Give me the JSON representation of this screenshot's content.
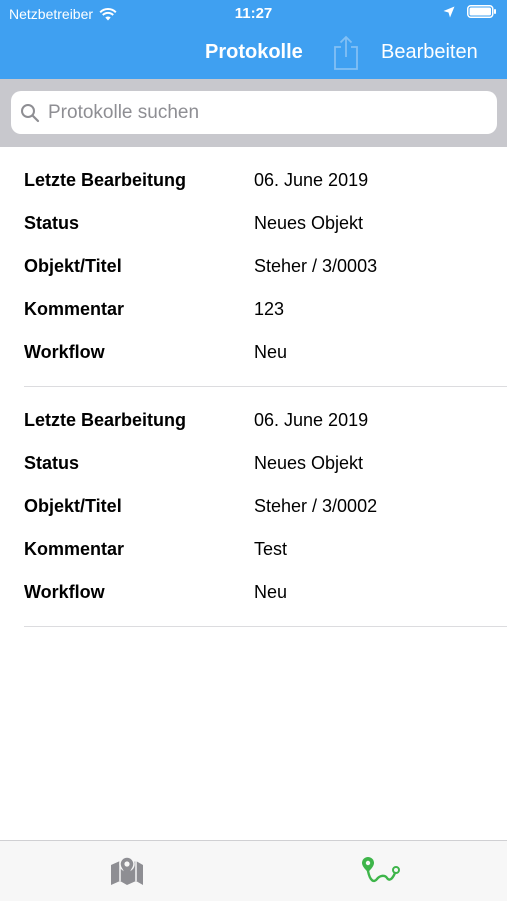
{
  "status_bar": {
    "carrier": "Netzbetreiber",
    "time": "11:27"
  },
  "nav": {
    "title": "Protokolle",
    "edit_label": "Bearbeiten"
  },
  "search": {
    "placeholder": "Protokolle suchen"
  },
  "records": [
    {
      "fields": [
        {
          "label": "Letzte Bearbeitung",
          "value": "06. June 2019"
        },
        {
          "label": "Status",
          "value": "Neues Objekt"
        },
        {
          "label": "Objekt/Titel",
          "value": "Steher / 3/0003"
        },
        {
          "label": "Kommentar",
          "value": "123"
        },
        {
          "label": "Workflow",
          "value": "Neu"
        }
      ]
    },
    {
      "fields": [
        {
          "label": "Letzte Bearbeitung",
          "value": "06. June 2019"
        },
        {
          "label": "Status",
          "value": "Neues Objekt"
        },
        {
          "label": "Objekt/Titel",
          "value": "Steher / 3/0002"
        },
        {
          "label": "Kommentar",
          "value": "Test"
        },
        {
          "label": "Workflow",
          "value": "Neu"
        }
      ]
    }
  ],
  "tabs": [
    {
      "icon": "map-icon",
      "active": false
    },
    {
      "icon": "route-icon",
      "active": true
    }
  ],
  "colors": {
    "accent": "#3fa0f1",
    "tab_inactive": "#8e8e93",
    "tab_active": "#3eb54a"
  }
}
